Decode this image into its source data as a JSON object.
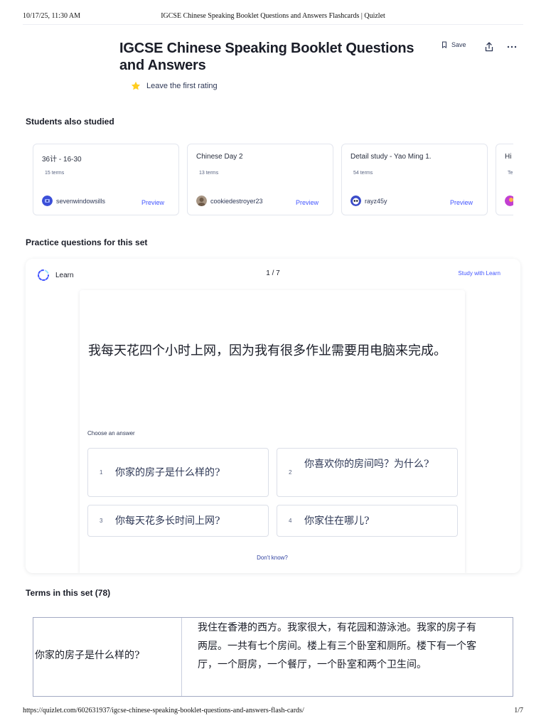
{
  "print": {
    "datetime": "10/17/25, 11:30 AM",
    "doc_title": "IGCSE Chinese Speaking Booklet Questions and Answers Flashcards | Quizlet",
    "url": "https://quizlet.com/602631937/igcse-chinese-speaking-booklet-questions-and-answers-flash-cards/",
    "page": "1/7"
  },
  "header": {
    "title": "IGCSE Chinese Speaking Booklet Questions and Answers",
    "rating_text": "Leave the first rating",
    "save_label": "Save"
  },
  "students_also_studied": {
    "heading": "Students also studied",
    "cards": [
      {
        "title": "36计 - 16-30",
        "terms": "15 terms",
        "user": "sevenwindowsills",
        "preview": "Preview",
        "avatar_color": "#3b4fd8"
      },
      {
        "title": "Chinese Day 2",
        "terms": "13 terms",
        "user": "cookiedestroyer23",
        "preview": "Preview",
        "avatar_color": "#9b8b7a"
      },
      {
        "title": "Detail study - Yao Ming 1.",
        "terms": "54 terms",
        "user": "rayz45y",
        "preview": "Preview",
        "avatar_color": "#3a4bc8"
      },
      {
        "title": "Hi",
        "terms": "Te",
        "user": "",
        "preview": "",
        "avatar_color": "#c23fd1"
      }
    ]
  },
  "practice": {
    "heading": "Practice questions for this set",
    "mode_label": "Learn",
    "counter": "1 / 7",
    "study_link": "Study with Learn",
    "question": "我每天花四个小时上网，因为我有很多作业需要用电脑来完成。",
    "choose_label": "Choose an answer",
    "answers": [
      {
        "num": "1",
        "text": "你家的房子是什么样的?"
      },
      {
        "num": "2",
        "text": "你喜欢你的房间吗？为什么?"
      },
      {
        "num": "3",
        "text": "你每天花多长时间上网?"
      },
      {
        "num": "4",
        "text": "你家住在哪儿?"
      }
    ],
    "dont_know": "Don't know?"
  },
  "terms": {
    "heading": "Terms in this set (78)",
    "rows": [
      {
        "term": "你家的房子是什么样的?",
        "definition": "我住在香港的西方。我家很大，有花园和游泳池。我家的房子有两层。一共有七个房间。楼上有三个卧室和厕所。楼下有一个客厅，一个厨房，一个餐厅，一个卧室和两个卫生间。"
      }
    ]
  },
  "colors": {
    "accent": "#4255ff",
    "text": "#282e3e",
    "star": "#ffcd1f"
  }
}
